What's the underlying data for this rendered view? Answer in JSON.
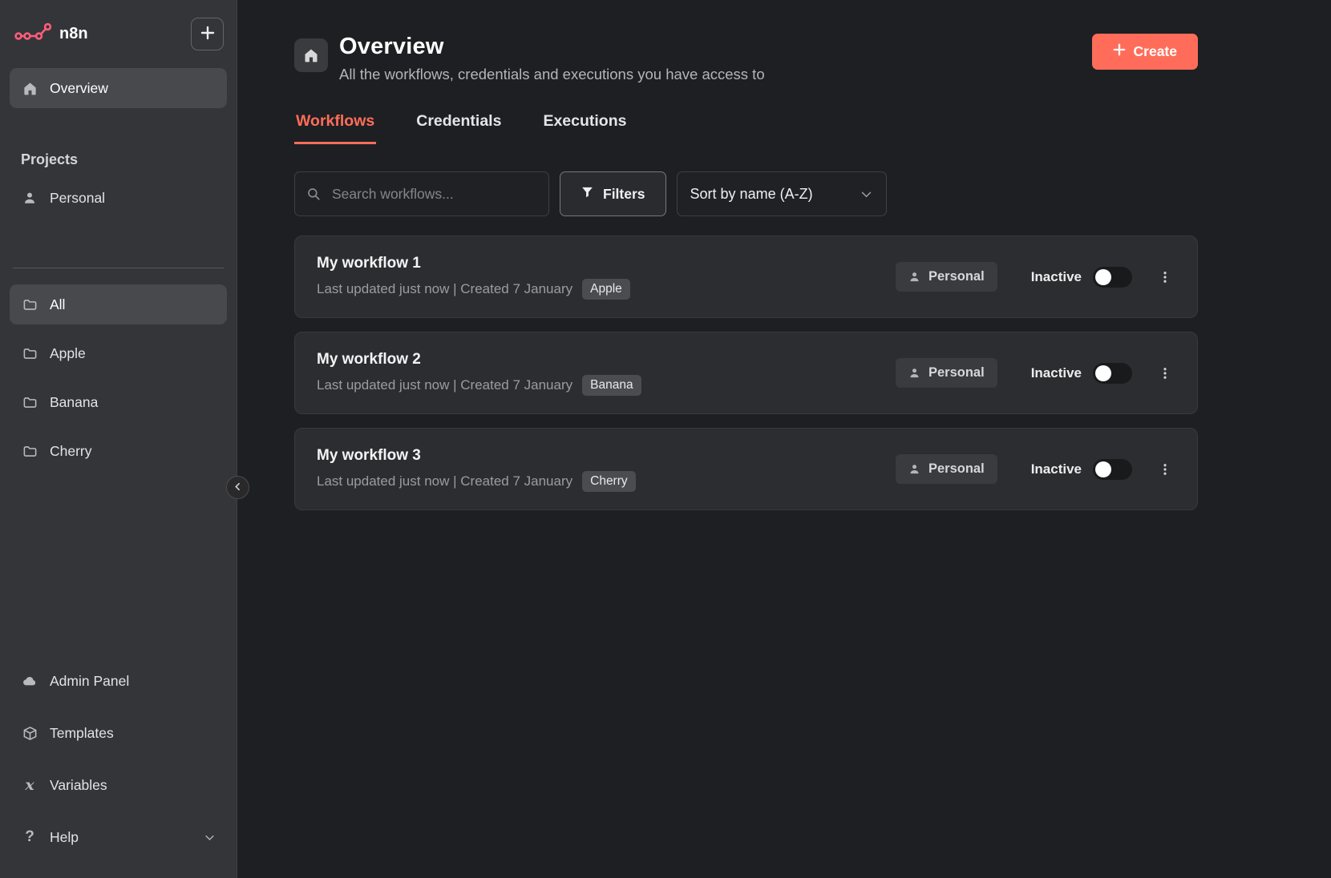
{
  "sidebar": {
    "logo_text": "n8n",
    "overview_label": "Overview",
    "projects_heading": "Projects",
    "personal_label": "Personal",
    "folders": [
      {
        "label": "All"
      },
      {
        "label": "Apple"
      },
      {
        "label": "Banana"
      },
      {
        "label": "Cherry"
      }
    ],
    "bottom": [
      {
        "label": "Admin Panel"
      },
      {
        "label": "Templates"
      },
      {
        "label": "Variables"
      },
      {
        "label": "Help"
      }
    ]
  },
  "icons": {
    "variables": "x",
    "help": "?"
  },
  "header": {
    "title": "Overview",
    "subtitle": "All the workflows, credentials and executions you have access to",
    "create_label": "Create"
  },
  "tabs": [
    {
      "label": "Workflows"
    },
    {
      "label": "Credentials"
    },
    {
      "label": "Executions"
    }
  ],
  "toolbar": {
    "search_placeholder": "Search workflows...",
    "filters_label": "Filters",
    "sort_value": "Sort by name (A-Z)"
  },
  "workflows": [
    {
      "name": "My workflow 1",
      "meta": "Last updated just now | Created 7 January",
      "tag": "Apple",
      "owner": "Personal",
      "status": "Inactive"
    },
    {
      "name": "My workflow 2",
      "meta": "Last updated just now | Created 7 January",
      "tag": "Banana",
      "owner": "Personal",
      "status": "Inactive"
    },
    {
      "name": "My workflow 3",
      "meta": "Last updated just now | Created 7 January",
      "tag": "Cherry",
      "owner": "Personal",
      "status": "Inactive"
    }
  ],
  "colors": {
    "accent": "#ff6d5a",
    "logo_pink": "#ff5d78"
  }
}
